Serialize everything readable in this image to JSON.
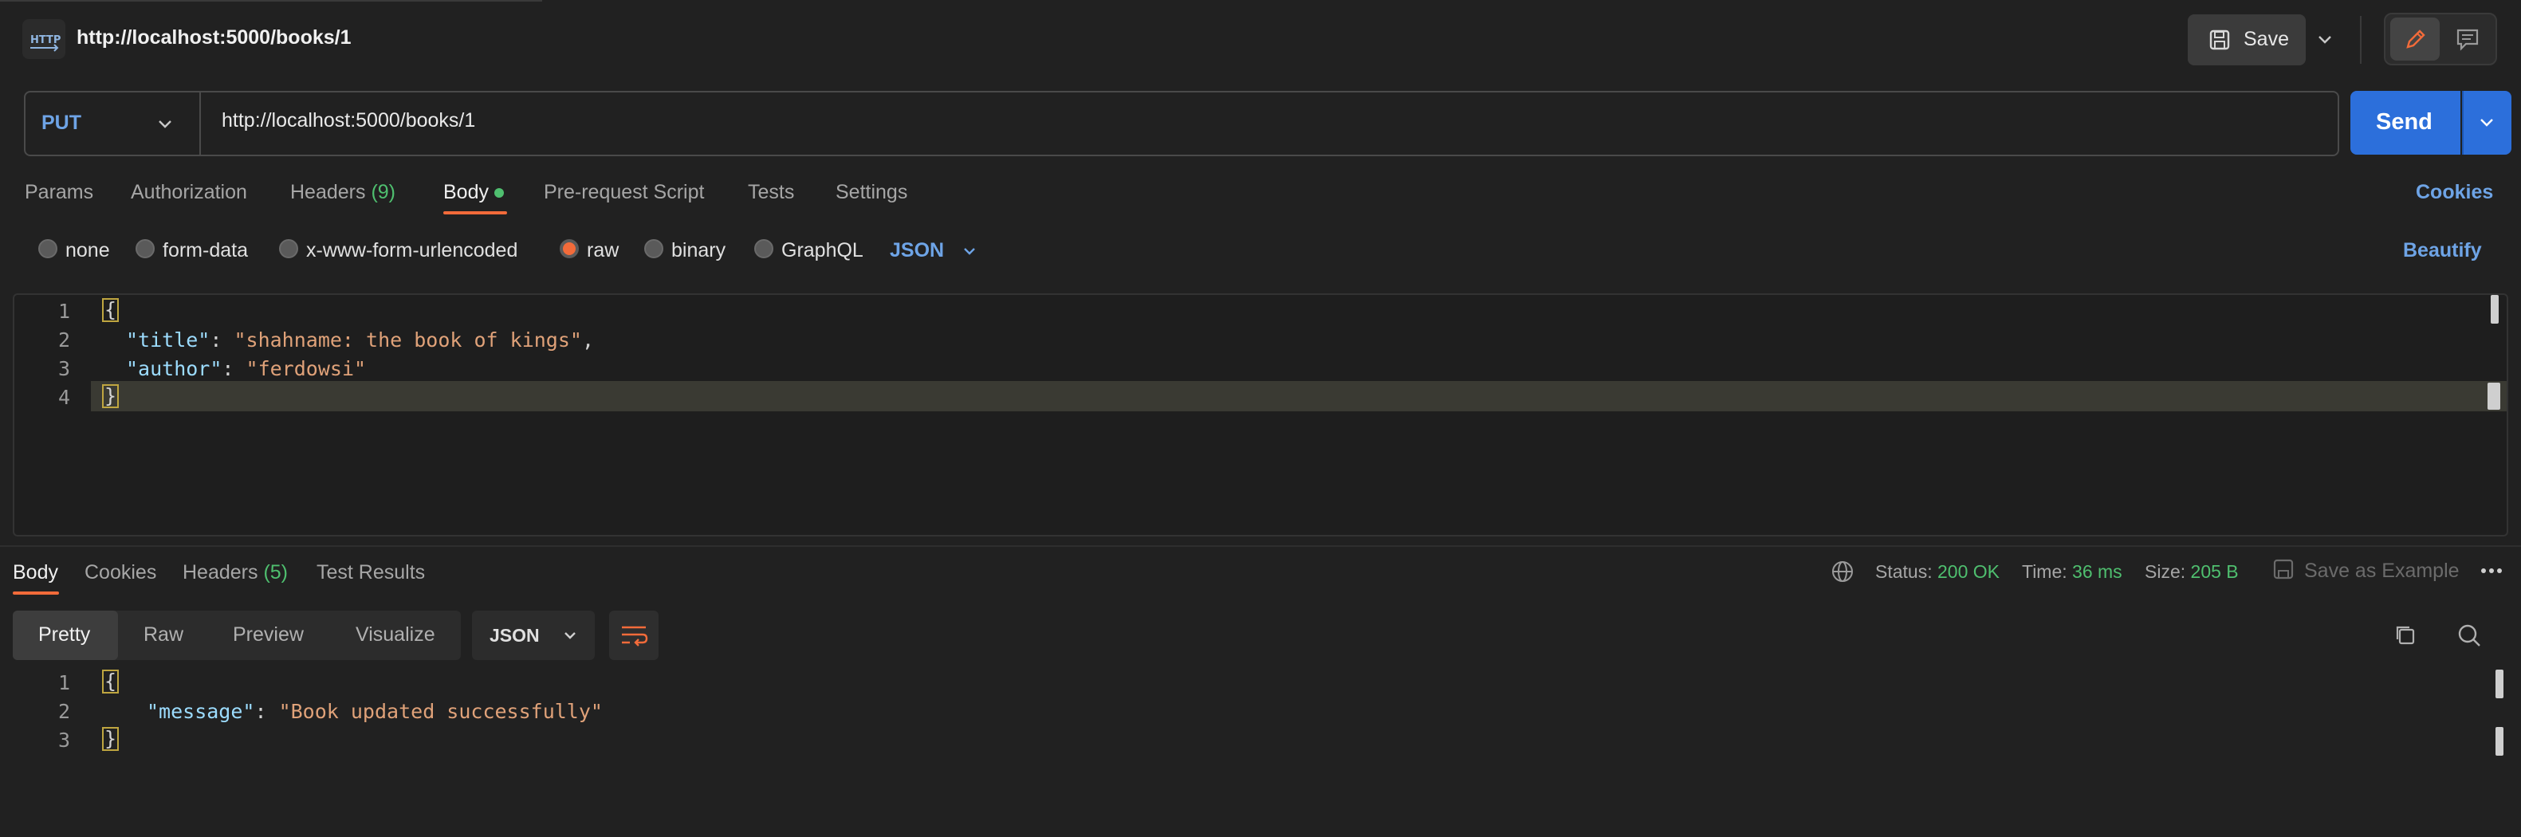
{
  "header": {
    "method_badge": "HTTP",
    "title": "http://localhost:5000/books/1",
    "save_label": "Save"
  },
  "request": {
    "method": "PUT",
    "url": "http://localhost:5000/books/1",
    "send_label": "Send",
    "tabs": [
      {
        "label": "Params"
      },
      {
        "label": "Authorization"
      },
      {
        "label": "Headers",
        "count": "(9)"
      },
      {
        "label": "Body"
      },
      {
        "label": "Pre-request Script"
      },
      {
        "label": "Tests"
      },
      {
        "label": "Settings"
      }
    ],
    "cookies_label": "Cookies",
    "body_types": [
      "none",
      "form-data",
      "x-www-form-urlencoded",
      "raw",
      "binary",
      "GraphQL"
    ],
    "selected_body_type": "raw",
    "format": "JSON",
    "beautify_label": "Beautify",
    "editor": {
      "line_numbers": [
        "1",
        "2",
        "3",
        "4"
      ],
      "open_brace": "{",
      "close_brace": "}",
      "title_key": "\"title\"",
      "title_value": "\"shahname: the book of kings\"",
      "author_key": "\"author\"",
      "author_value": "\"ferdowsi\""
    }
  },
  "response": {
    "tabs": [
      {
        "label": "Body"
      },
      {
        "label": "Cookies"
      },
      {
        "label": "Headers",
        "count": "(5)"
      },
      {
        "label": "Test Results"
      }
    ],
    "status_label": "Status:",
    "status_value": "200 OK",
    "time_label": "Time:",
    "time_value": "36 ms",
    "size_label": "Size:",
    "size_value": "205 B",
    "save_example_label": "Save as Example",
    "view_modes": [
      "Pretty",
      "Raw",
      "Preview",
      "Visualize"
    ],
    "format": "JSON",
    "editor": {
      "line_numbers": [
        "1",
        "2",
        "3"
      ],
      "open_brace": "{",
      "close_brace": "}",
      "message_key": "\"message\"",
      "message_value": "\"Book updated successfully\""
    }
  },
  "colors": {
    "accent": "#f26b3a",
    "link": "#6ea4e6",
    "send": "#2c6fdb",
    "success": "#4fbf6f"
  }
}
